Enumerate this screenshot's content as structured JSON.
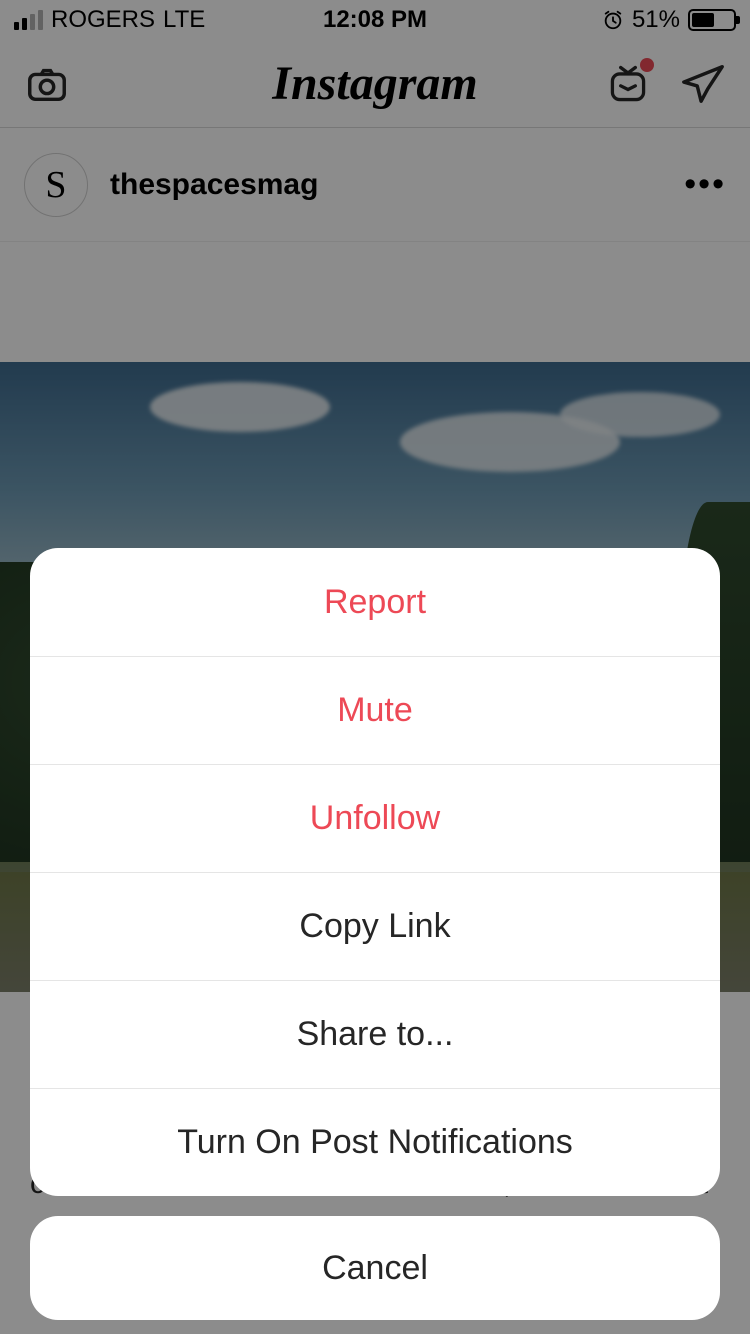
{
  "status_bar": {
    "carrier": "ROGERS",
    "network": "LTE",
    "time": "12:08 PM",
    "battery_pct": "51%"
  },
  "nav": {
    "brand": "Instagram"
  },
  "post": {
    "username": "thespacesmag",
    "avatar_letter": "S",
    "caption_fragment": "cabin on Vallisaari island in Helsinki,  is a minimalist"
  },
  "sheet": {
    "items": [
      {
        "label": "Report",
        "destructive": true
      },
      {
        "label": "Mute",
        "destructive": true
      },
      {
        "label": "Unfollow",
        "destructive": true
      },
      {
        "label": "Copy Link",
        "destructive": false
      },
      {
        "label": "Share to...",
        "destructive": false
      },
      {
        "label": "Turn On Post Notifications",
        "destructive": false
      }
    ],
    "cancel": "Cancel"
  }
}
